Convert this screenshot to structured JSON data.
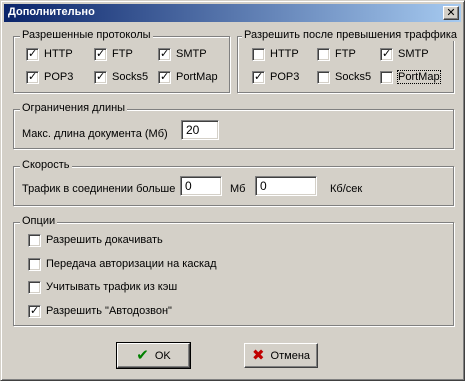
{
  "window": {
    "title": "Дополнительно",
    "close_glyph": "✕"
  },
  "protocols": {
    "legend": "Разрешенные протоколы",
    "items": [
      {
        "label": "HTTP",
        "checked": true
      },
      {
        "label": "FTP",
        "checked": true
      },
      {
        "label": "SMTP",
        "checked": true
      },
      {
        "label": "POP3",
        "checked": true
      },
      {
        "label": "Socks5",
        "checked": true
      },
      {
        "label": "PortMap",
        "checked": true
      }
    ]
  },
  "after_limit": {
    "legend": "Разрешить после превышения траффика",
    "items": [
      {
        "label": "HTTP",
        "checked": false
      },
      {
        "label": "FTP",
        "checked": false
      },
      {
        "label": "SMTP",
        "checked": true
      },
      {
        "label": "POP3",
        "checked": true
      },
      {
        "label": "Socks5",
        "checked": false
      },
      {
        "label": "PortMap",
        "checked": false
      }
    ]
  },
  "length_limit": {
    "legend": "Ограничения длины",
    "label": "Макс. длина документа (Мб)",
    "value": "20"
  },
  "speed": {
    "legend": "Скорость",
    "label": "Трафик в соединении больше",
    "value_mb": "0",
    "unit_mb": "Мб",
    "value_kb": "0",
    "unit_kb": "Кб/сек"
  },
  "options": {
    "legend": "Опции",
    "items": [
      {
        "label": "Разрешить докачивать",
        "checked": false
      },
      {
        "label": "Передача авторизации на каскад",
        "checked": false
      },
      {
        "label": "Учитывать трафик из кэш",
        "checked": false
      },
      {
        "label": "Разрешить \"Автодозвон\"",
        "checked": true
      }
    ]
  },
  "buttons": {
    "ok_label": "OK",
    "ok_icon": "✔",
    "cancel_label": "Отмена",
    "cancel_icon": "✖"
  },
  "colors": {
    "ok_icon": "#008000",
    "cancel_icon": "#c00000",
    "title_bar": "#0a246a"
  },
  "check_glyph": "✓"
}
